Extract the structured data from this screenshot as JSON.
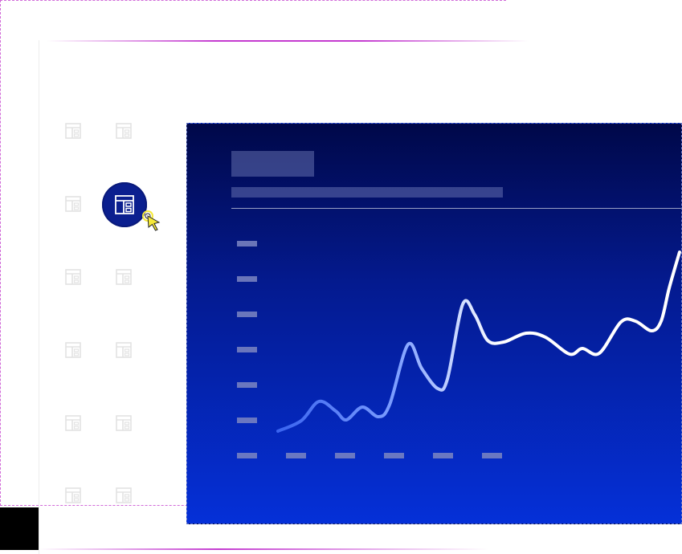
{
  "app": {
    "title": "",
    "colors": {
      "panel_top": "#000849",
      "panel_bottom": "#0530d8",
      "accent": "#0b1f8f",
      "frame": "#d16ad8",
      "line_start": "#3a64f0",
      "line_end": "#ffffff",
      "placeholder": "#7d86c2"
    }
  },
  "sidebar": {
    "icons": [
      {
        "name": "layout-icon"
      },
      {
        "name": "layout-icon"
      },
      {
        "name": "layout-icon"
      },
      {
        "name": "layout-icon",
        "selected": true
      },
      {
        "name": "layout-icon"
      },
      {
        "name": "layout-icon"
      },
      {
        "name": "layout-icon"
      },
      {
        "name": "layout-icon"
      },
      {
        "name": "layout-icon"
      },
      {
        "name": "layout-icon"
      },
      {
        "name": "layout-icon"
      },
      {
        "name": "layout-icon"
      }
    ],
    "cursor": "pointer-cursor-icon"
  },
  "chart_data": {
    "type": "line",
    "title": "",
    "subtitle": "",
    "xlabel": "",
    "ylabel": "",
    "y_ticks": 7,
    "x_ticks": 5,
    "grid": false,
    "series": [
      {
        "x": [
          0,
          0.5,
          1,
          1.3,
          1.6,
          1.8,
          2.2,
          2.5,
          2.8,
          3.1,
          3.3,
          3.6,
          3.8,
          4.1,
          4.4,
          4.7,
          5.0,
          5.3,
          5.6,
          6.0,
          6.5,
          6.9,
          7.4,
          7.6,
          7.8,
          8.3,
          8.6,
          8.9
        ],
        "values": [
          0.65,
          0.95,
          1.75,
          1.45,
          1.1,
          1.55,
          1.15,
          3.1,
          2.35,
          1.9,
          4.6,
          3.45,
          3.2,
          3.3,
          3.45,
          3.25,
          2.95,
          3.1,
          2.85,
          3.8,
          3.45,
          5.8,
          5.8,
          5.8,
          5.8,
          5.8,
          5.8,
          5.8
        ]
      }
    ]
  }
}
